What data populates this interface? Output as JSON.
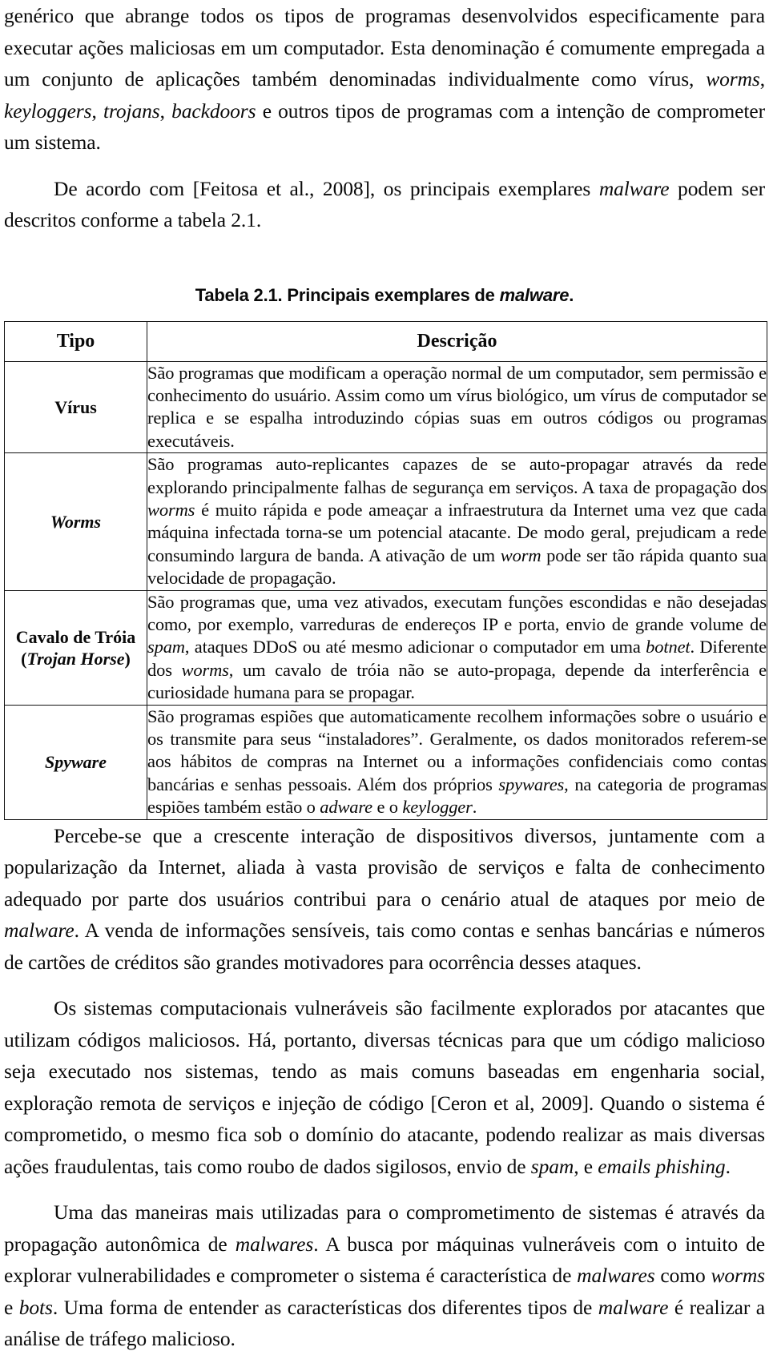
{
  "document": {
    "paragraphs_before_table": [
      {
        "id": "par-malware-definition",
        "indent": false,
        "runs": [
          {
            "text": "genérico que abrange todos os tipos de programas desenvolvidos especificamente para executar ações maliciosas em um computador. Esta denominação é comumente empregada a um conjunto de aplicações também denominadas individualmente como vírus, ",
            "style": "normal"
          },
          {
            "text": "worms",
            "style": "italic"
          },
          {
            "text": ", ",
            "style": "normal"
          },
          {
            "text": "keyloggers",
            "style": "italic"
          },
          {
            "text": ", ",
            "style": "normal"
          },
          {
            "text": "trojans",
            "style": "italic"
          },
          {
            "text": ", ",
            "style": "normal"
          },
          {
            "text": "backdoors",
            "style": "italic"
          },
          {
            "text": " e outros tipos de programas com a intenção de comprometer um sistema.",
            "style": "normal"
          }
        ]
      },
      {
        "id": "par-feitosa-reference",
        "indent": true,
        "runs": [
          {
            "text": "De acordo com [Feitosa et al., 2008], os principais exemplares ",
            "style": "normal"
          },
          {
            "text": "malware",
            "style": "italic"
          },
          {
            "text": " podem ser descritos conforme a tabela 2.1.",
            "style": "normal"
          }
        ]
      }
    ],
    "table": {
      "caption": {
        "prefix": "Tabela 2.1. Principais exemplares de ",
        "italic_word": "malware",
        "suffix": "."
      },
      "headers": [
        "Tipo",
        "Descrição"
      ],
      "rows": [
        {
          "type_runs": [
            {
              "text": "Vírus",
              "style": "bold"
            }
          ],
          "description_runs": [
            {
              "text": "São programas que modificam a operação normal de um computador, sem permissão e conhecimento do usuário. Assim como um vírus biológico, um vírus de computador se replica e se espalha introduzindo cópias suas em outros códigos ou programas executáveis.",
              "style": "normal"
            }
          ]
        },
        {
          "type_runs": [
            {
              "text": "Worms",
              "style": "bold-italic"
            }
          ],
          "description_runs": [
            {
              "text": "São programas auto-replicantes capazes de se auto-propagar através da rede explorando principalmente falhas de segurança em serviços. A taxa de propagação dos ",
              "style": "normal"
            },
            {
              "text": "worms",
              "style": "italic"
            },
            {
              "text": " é muito rápida e pode ameaçar a infraestrutura da Internet uma vez que cada máquina infectada torna-se um potencial atacante. De modo geral, prejudicam a rede consumindo largura de banda. A ativação de um ",
              "style": "normal"
            },
            {
              "text": "worm",
              "style": "italic"
            },
            {
              "text": " pode ser tão rápida quanto sua velocidade de propagação.",
              "style": "normal"
            }
          ]
        },
        {
          "type_runs": [
            {
              "text": "Cavalo de Tróia",
              "style": "bold"
            },
            {
              "text": "\n",
              "style": "break"
            },
            {
              "text": "(",
              "style": "bold"
            },
            {
              "text": "Trojan Horse",
              "style": "bold-italic"
            },
            {
              "text": ")",
              "style": "bold"
            }
          ],
          "description_runs": [
            {
              "text": "São programas que, uma vez ativados, executam funções escondidas e não desejadas como, por exemplo, varreduras de endereços IP e porta, envio de grande volume de ",
              "style": "normal"
            },
            {
              "text": "spam",
              "style": "italic"
            },
            {
              "text": ", ataques DDoS ou até mesmo adicionar o computador em uma ",
              "style": "normal"
            },
            {
              "text": "botnet",
              "style": "italic"
            },
            {
              "text": ". Diferente dos ",
              "style": "normal"
            },
            {
              "text": "worms",
              "style": "italic"
            },
            {
              "text": ", um cavalo de tróia não se auto-propaga, depende da interferência e curiosidade humana para se propagar.",
              "style": "normal"
            }
          ]
        },
        {
          "type_runs": [
            {
              "text": "Spyware",
              "style": "bold-italic"
            }
          ],
          "description_runs": [
            {
              "text": "São programas espiões que automaticamente recolhem informações sobre o usuário e os transmite para seus “instaladores”. Geralmente, os dados monitorados referem-se aos hábitos de compras na Internet ou a informações confidenciais como contas bancárias e senhas pessoais. Além dos próprios ",
              "style": "normal"
            },
            {
              "text": "spywares",
              "style": "italic"
            },
            {
              "text": ", na categoria de programas espiões também estão o ",
              "style": "normal"
            },
            {
              "text": "adware",
              "style": "italic"
            },
            {
              "text": " e o ",
              "style": "normal"
            },
            {
              "text": "keylogger",
              "style": "italic"
            },
            {
              "text": ".",
              "style": "normal"
            }
          ]
        }
      ]
    },
    "paragraphs_after_table": [
      {
        "id": "par-percebe-se",
        "indent": true,
        "runs": [
          {
            "text": "Percebe-se que a crescente interação de dispositivos diversos, juntamente com a popularização da Internet, aliada à vasta provisão de serviços e falta de conhecimento adequado por parte dos usuários contribui para o cenário atual de ataques por meio de ",
            "style": "normal"
          },
          {
            "text": "malware",
            "style": "italic"
          },
          {
            "text": ". A venda de informações sensíveis, tais como contas e senhas bancárias e números de cartões de créditos são grandes motivadores para ocorrência desses ataques.",
            "style": "normal"
          }
        ]
      },
      {
        "id": "par-sistemas-vulneraveis",
        "indent": true,
        "runs": [
          {
            "text": "Os sistemas computacionais vulneráveis são facilmente explorados por atacantes que utilizam códigos maliciosos. Há, portanto, diversas técnicas para que um código malicioso seja executado nos sistemas, tendo as mais comuns baseadas em engenharia social, exploração remota de serviços e injeção de código [Ceron et al, 2009]. Quando o sistema é comprometido, o mesmo fica sob o domínio do atacante, podendo realizar as mais diversas ações fraudulentas, tais como roubo de dados sigilosos, envio de ",
            "style": "normal"
          },
          {
            "text": "spam",
            "style": "italic"
          },
          {
            "text": ", e ",
            "style": "normal"
          },
          {
            "text": "emails phishing",
            "style": "italic"
          },
          {
            "text": ".",
            "style": "normal"
          }
        ]
      },
      {
        "id": "par-propagacao-autonomica",
        "indent": true,
        "runs": [
          {
            "text": "Uma das maneiras mais utilizadas para o comprometimento de sistemas é através da propagação autonômica de ",
            "style": "normal"
          },
          {
            "text": "malwares",
            "style": "italic"
          },
          {
            "text": ". A busca por máquinas vulneráveis com o intuito de explorar vulnerabilidades e comprometer o sistema é característica de ",
            "style": "normal"
          },
          {
            "text": "malwares",
            "style": "italic"
          },
          {
            "text": " como ",
            "style": "normal"
          },
          {
            "text": "worms",
            "style": "italic"
          },
          {
            "text": " e ",
            "style": "normal"
          },
          {
            "text": "bots",
            "style": "italic"
          },
          {
            "text": ". Uma forma de entender as características dos diferentes tipos de ",
            "style": "normal"
          },
          {
            "text": "malware",
            "style": "italic"
          },
          {
            "text": " é realizar a análise de tráfego malicioso.",
            "style": "normal"
          }
        ]
      }
    ]
  },
  "colors": {
    "text": "#0a0a0a",
    "background": "#ffffff",
    "table_border": "#111111"
  }
}
